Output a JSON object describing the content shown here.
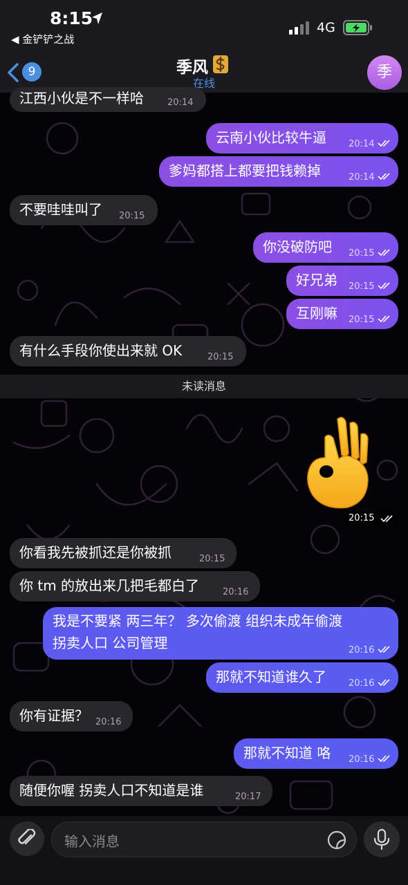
{
  "status_bar": {
    "time": "8:15",
    "back_app": "◀ 金铲铲之战",
    "network": "4G"
  },
  "header": {
    "back_count": "9",
    "contact_name": "季风",
    "contact_status": "在线",
    "avatar_letter": "季",
    "accent_color": "#4a8fe0"
  },
  "messages": [
    {
      "dir": "in",
      "text": "江西小伙是不一样哈",
      "time": "20:14"
    },
    {
      "dir": "out",
      "text": "云南小伙比较牛逼",
      "time": "20:14",
      "read": true
    },
    {
      "dir": "out",
      "text": "爹妈都搭上都要把钱赖掉",
      "time": "20:14",
      "read": true
    },
    {
      "dir": "in",
      "text": "不要哇哇叫了",
      "time": "20:15"
    },
    {
      "dir": "out",
      "text": "你没破防吧",
      "time": "20:15",
      "read": true
    },
    {
      "dir": "out",
      "text": "好兄弟",
      "time": "20:15",
      "read": true
    },
    {
      "dir": "out",
      "text": "互刚嘛",
      "time": "20:15",
      "read": true
    },
    {
      "dir": "in",
      "text": "有什么手段你使出来就 OK",
      "time": "20:15"
    },
    {
      "dir": "out",
      "sticker": "ok-hand-emoji",
      "time": "20:15",
      "read": true
    },
    {
      "dir": "in",
      "text": "你看我先被抓还是你被抓",
      "time": "20:15"
    },
    {
      "dir": "in",
      "text": "你 tm 的放出来几把毛都白了",
      "time": "20:16"
    },
    {
      "dir": "out",
      "text_line1": "我是不要紧 两三年？ 多次偷渡 组织未成年偷渡",
      "text_line2": "拐卖人口 公司管理",
      "time": "20:16",
      "read": true
    },
    {
      "dir": "out",
      "text": "那就不知道谁久了",
      "time": "20:16",
      "read": true
    },
    {
      "dir": "in",
      "text": "你有证据？",
      "time": "20:16"
    },
    {
      "dir": "out",
      "text": "那就不知道 咯",
      "time": "20:16",
      "read": true
    },
    {
      "dir": "in",
      "text": "随便你喔 拐卖人口不知道是谁",
      "time": "20:17"
    }
  ],
  "unread_divider": "未读消息",
  "input": {
    "placeholder": "输入消息"
  },
  "colors": {
    "outgoing_bubble": "#8c4fe4",
    "outgoing_bubble_blue": "#5e5af0",
    "incoming_bubble": "#2a262e"
  }
}
